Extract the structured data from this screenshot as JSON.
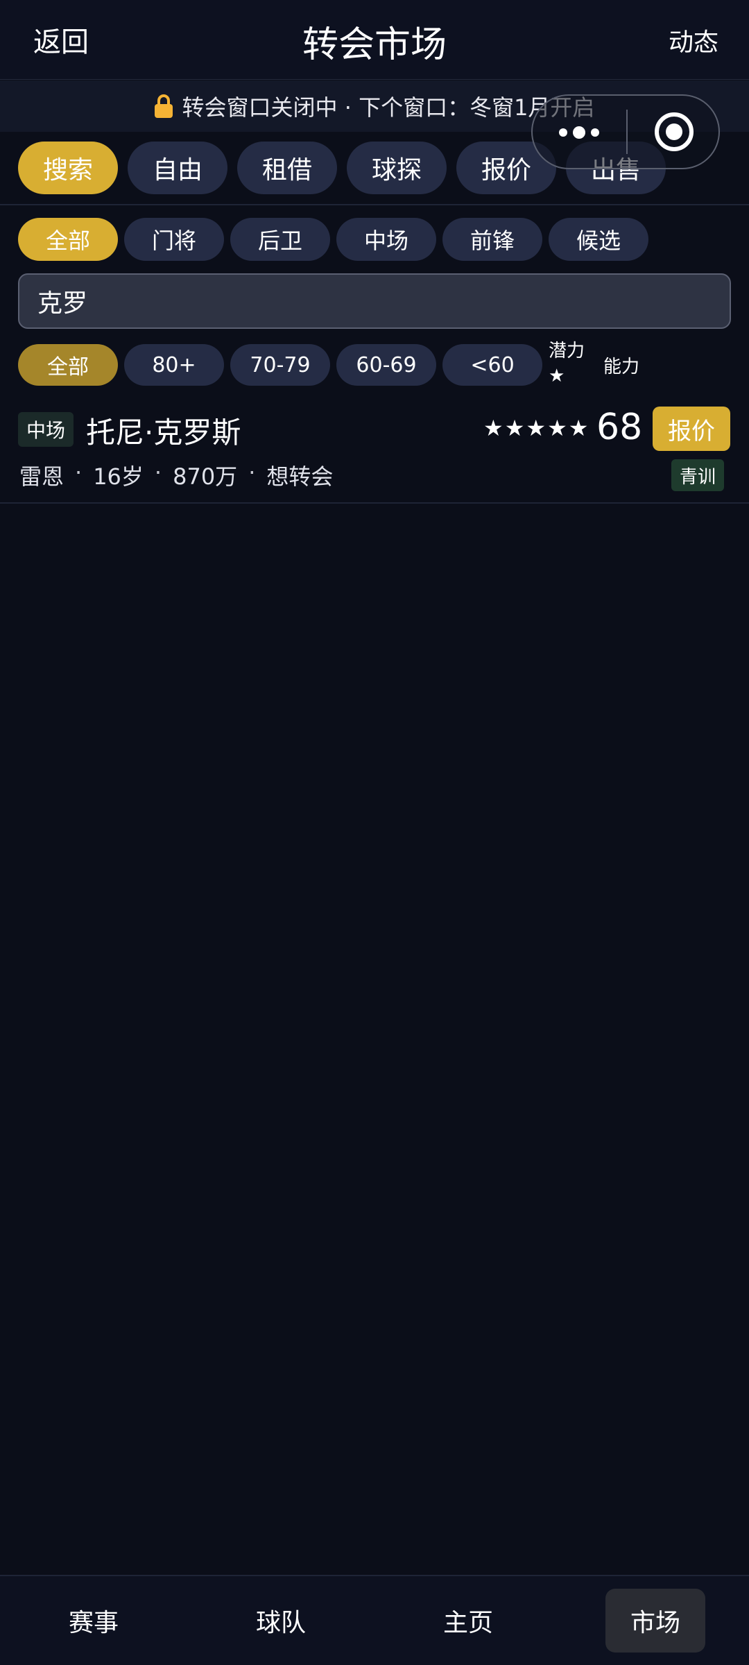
{
  "header": {
    "back_label": "返回",
    "title": "转会市场",
    "dynamic_label": "动态"
  },
  "banner": {
    "icon": "lock-icon",
    "text": "转会窗口关闭中 · 下个窗口：冬窗1月开启"
  },
  "tabs": [
    {
      "label": "搜索",
      "active": true
    },
    {
      "label": "自由",
      "active": false
    },
    {
      "label": "租借",
      "active": false
    },
    {
      "label": "球探",
      "active": false
    },
    {
      "label": "报价",
      "active": false
    },
    {
      "label": "出售",
      "active": false
    }
  ],
  "position_filter": [
    {
      "label": "全部",
      "active": true
    },
    {
      "label": "门将",
      "active": false
    },
    {
      "label": "后卫",
      "active": false
    },
    {
      "label": "中场",
      "active": false
    },
    {
      "label": "前锋",
      "active": false
    },
    {
      "label": "候选",
      "active": false
    }
  ],
  "search": {
    "value": "克罗"
  },
  "rating_filter": [
    {
      "label": "全部",
      "active": true
    },
    {
      "label": "80+",
      "active": false
    },
    {
      "label": "70-79",
      "active": false
    },
    {
      "label": "60-69",
      "active": false
    },
    {
      "label": "<60",
      "active": false
    }
  ],
  "sort": {
    "potential_label": "潜力★",
    "ability_label": "能力"
  },
  "players": [
    {
      "position": "中场",
      "name": "托尼·克罗斯",
      "stars": "★★★★★",
      "rating": "68",
      "offer_label": "报价",
      "club": "雷恩",
      "age": "16岁",
      "value": "870万",
      "status": "想转会",
      "tag": "青训"
    }
  ],
  "bottom_nav": [
    {
      "label": "赛事",
      "active": false
    },
    {
      "label": "球队",
      "active": false
    },
    {
      "label": "主页",
      "active": false
    },
    {
      "label": "市场",
      "active": true
    }
  ],
  "colors": {
    "background": "#0b0e19",
    "accent": "#d8ae32",
    "pill": "#252c45",
    "lock": "#f5b335"
  }
}
